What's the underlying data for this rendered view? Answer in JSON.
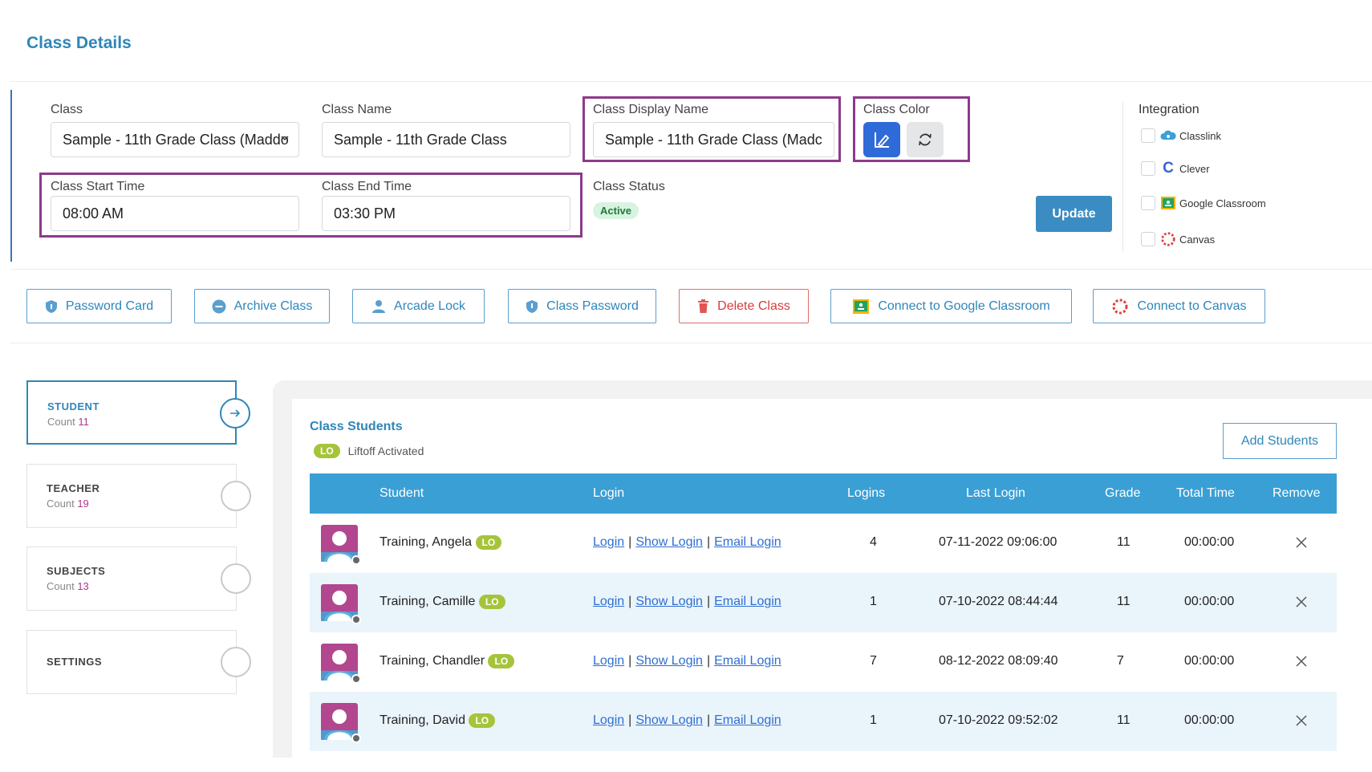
{
  "page": {
    "title": "Class Details"
  },
  "form": {
    "class_label": "Class",
    "class_value": "Sample - 11th Grade Class (Maddo",
    "class_name_label": "Class Name",
    "class_name_value": "Sample - 11th Grade Class",
    "display_name_label": "Class Display Name",
    "display_name_value": "Sample - 11th Grade Class (Madc",
    "color_label": "Class Color",
    "start_label": "Class Start Time",
    "start_value": "08:00 AM",
    "end_label": "Class End Time",
    "end_value": "03:30 PM",
    "status_label": "Class Status",
    "status_value": "Active",
    "update_label": "Update"
  },
  "integration": {
    "title": "Integration",
    "items": [
      "Classlink",
      "Clever",
      "Google Classroom",
      "Canvas"
    ]
  },
  "actions": {
    "password_card": "Password Card",
    "archive_class": "Archive Class",
    "arcade_lock": "Arcade Lock",
    "class_password": "Class Password",
    "delete_class": "Delete Class",
    "connect_google": "Connect to Google Classroom",
    "connect_canvas": "Connect to Canvas"
  },
  "sidebar": {
    "count_label": "Count",
    "items": [
      {
        "title": "STUDENT",
        "count": "11"
      },
      {
        "title": "TEACHER",
        "count": "19"
      },
      {
        "title": "SUBJECTS",
        "count": "13"
      },
      {
        "title": "SETTINGS",
        "count": ""
      }
    ]
  },
  "students": {
    "title": "Class Students",
    "lo_badge": "LO",
    "lo_legend": "Liftoff Activated",
    "add_button": "Add Students",
    "columns": [
      "Student",
      "Login",
      "Logins",
      "Last Login",
      "Grade",
      "Total Time",
      "Remove"
    ],
    "link_labels": [
      "Login",
      "Show Login",
      "Email Login"
    ],
    "rows": [
      {
        "name": "Training, Angela",
        "logins": "4",
        "last_login": "07-11-2022 09:06:00",
        "grade": "11",
        "total_time": "00:00:00"
      },
      {
        "name": "Training, Camille",
        "logins": "1",
        "last_login": "07-10-2022 08:44:44",
        "grade": "11",
        "total_time": "00:00:00"
      },
      {
        "name": "Training, Chandler",
        "logins": "7",
        "last_login": "08-12-2022 08:09:40",
        "grade": "7",
        "total_time": "00:00:00"
      },
      {
        "name": "Training, David",
        "logins": "1",
        "last_login": "07-10-2022 09:52:02",
        "grade": "11",
        "total_time": "00:00:00"
      }
    ]
  },
  "colors": {
    "accent": "#2f86b8",
    "highlight": "#8e3a8a",
    "header_bg": "#3a9fd5",
    "lo_green": "#a6c43a",
    "danger": "#d93b3b"
  }
}
